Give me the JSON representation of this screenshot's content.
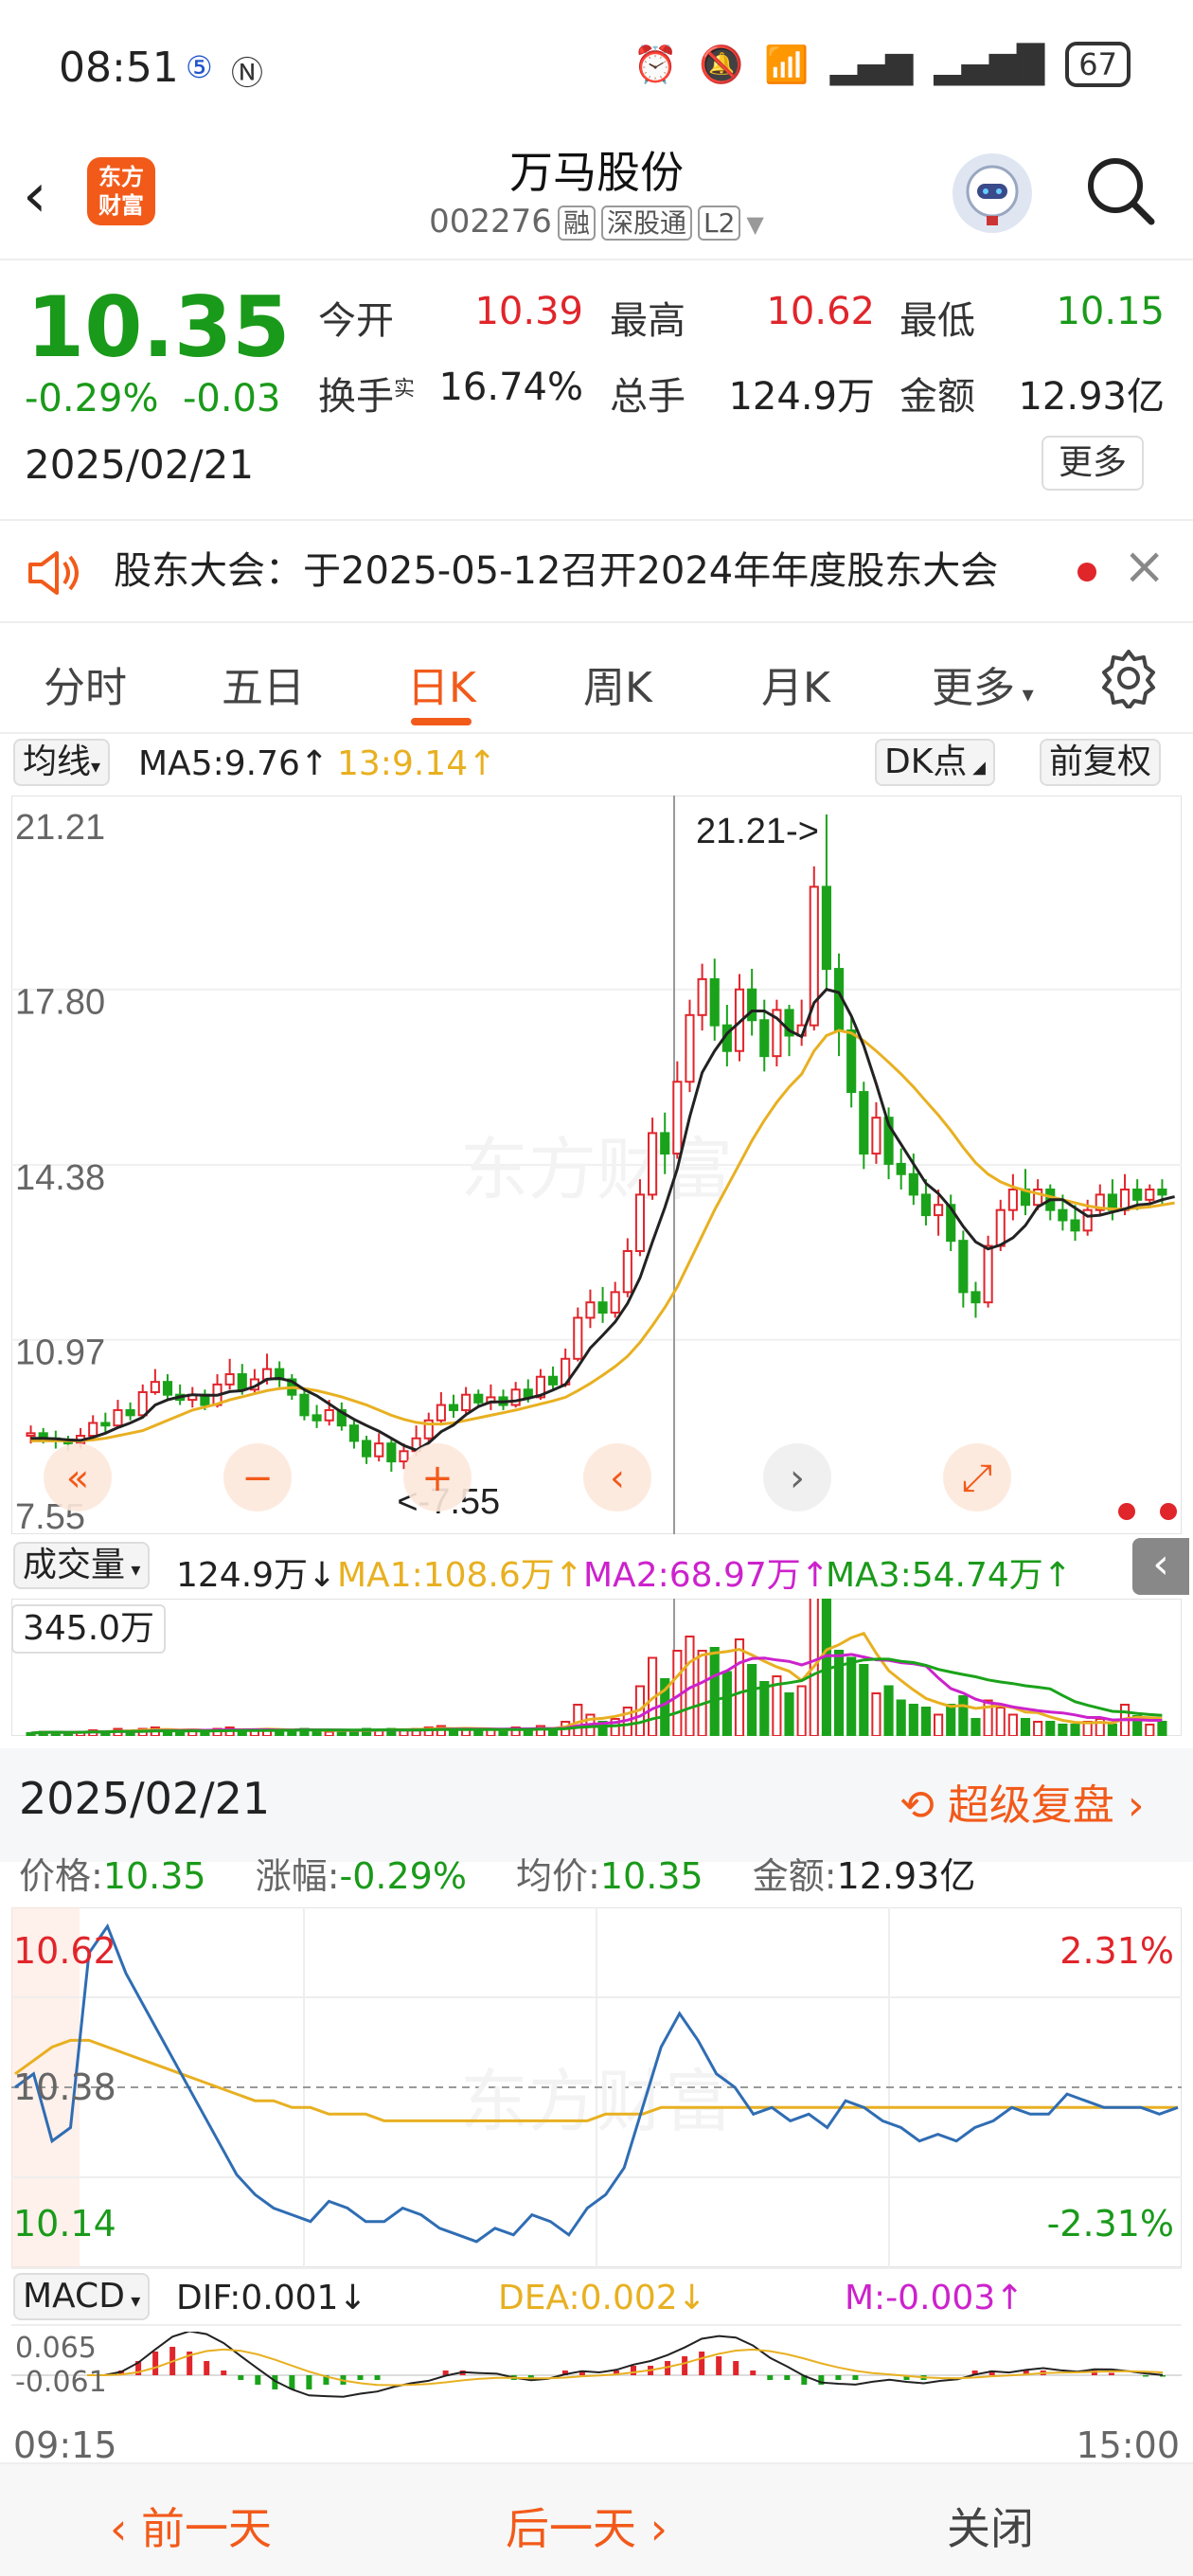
{
  "status": {
    "time": "08:51",
    "battery": "67"
  },
  "header": {
    "logo_line1": "东方",
    "logo_line2": "财富",
    "title": "万马股份",
    "code": "002276",
    "tags": [
      "融",
      "深股通",
      "L2"
    ]
  },
  "quote": {
    "price": "10.35",
    "change_pct": "-0.29%",
    "change_abs": "-0.03",
    "date": "2025/02/21",
    "open_label": "今开",
    "open": "10.39",
    "high_label": "最高",
    "high": "10.62",
    "low_label": "最低",
    "low": "10.15",
    "turnover_label": "换手",
    "turnover_sup": "实",
    "turnover": "16.74%",
    "volume_label": "总手",
    "volume": "124.9万",
    "amount_label": "金额",
    "amount": "12.93亿",
    "more": "更多"
  },
  "notice": {
    "text": "股东大会：于2025-05-12召开2024年年度股东大会"
  },
  "tabs": [
    "分时",
    "五日",
    "日K",
    "周K",
    "月K",
    "更多"
  ],
  "active_tab": "日K",
  "ma_bar": {
    "selector": "均线",
    "ma5": "MA5:9.76↑",
    "ma13": "13:9.14↑",
    "dk": "DK点",
    "fq": "前复权"
  },
  "kline": {
    "y_labels": [
      "21.21",
      "17.80",
      "14.38",
      "10.97",
      "7.55"
    ],
    "max_annot": "21.21->",
    "min_annot": "<-7.55",
    "watermark": "东方财富",
    "colors": {
      "up": "#e0252b",
      "down": "#1aa31a",
      "ma5": "#222222",
      "ma13": "#e8b021"
    },
    "candles": [
      [
        9.1,
        9.15,
        8.95,
        9.3
      ],
      [
        9.15,
        9.05,
        8.95,
        9.25
      ],
      [
        9.05,
        9.0,
        8.85,
        9.2
      ],
      [
        9.0,
        8.95,
        8.8,
        9.1
      ],
      [
        8.95,
        9.1,
        8.85,
        9.25
      ],
      [
        9.1,
        9.35,
        9.05,
        9.5
      ],
      [
        9.35,
        9.3,
        9.15,
        9.55
      ],
      [
        9.3,
        9.6,
        9.25,
        9.8
      ],
      [
        9.6,
        9.5,
        9.4,
        9.75
      ],
      [
        9.5,
        9.95,
        9.45,
        10.1
      ],
      [
        9.95,
        10.15,
        9.9,
        10.4
      ],
      [
        10.15,
        9.9,
        9.8,
        10.3
      ],
      [
        9.9,
        9.8,
        9.7,
        10.1
      ],
      [
        9.8,
        9.9,
        9.65,
        10.05
      ],
      [
        9.9,
        9.7,
        9.6,
        10.0
      ],
      [
        9.7,
        10.1,
        9.65,
        10.3
      ],
      [
        10.1,
        10.3,
        10.0,
        10.6
      ],
      [
        10.3,
        10.0,
        9.9,
        10.5
      ],
      [
        10.0,
        10.2,
        9.9,
        10.4
      ],
      [
        10.2,
        10.4,
        10.1,
        10.7
      ],
      [
        10.4,
        10.2,
        10.05,
        10.55
      ],
      [
        10.2,
        9.9,
        9.8,
        10.3
      ],
      [
        9.9,
        9.5,
        9.4,
        10.0
      ],
      [
        9.5,
        9.4,
        9.25,
        9.7
      ],
      [
        9.4,
        9.6,
        9.3,
        9.8
      ],
      [
        9.6,
        9.3,
        9.2,
        9.75
      ],
      [
        9.3,
        9.0,
        8.85,
        9.4
      ],
      [
        9.0,
        8.7,
        8.55,
        9.1
      ],
      [
        8.7,
        8.95,
        8.6,
        9.15
      ],
      [
        8.95,
        8.6,
        8.4,
        9.05
      ],
      [
        8.6,
        8.8,
        8.45,
        8.95
      ],
      [
        8.8,
        9.05,
        8.7,
        9.3
      ],
      [
        9.05,
        9.4,
        8.95,
        9.55
      ],
      [
        9.4,
        9.7,
        9.3,
        9.95
      ],
      [
        9.7,
        9.6,
        9.45,
        9.9
      ],
      [
        9.6,
        9.9,
        9.5,
        10.05
      ],
      [
        9.9,
        9.75,
        9.65,
        10.0
      ],
      [
        9.75,
        9.85,
        9.6,
        10.1
      ],
      [
        9.85,
        9.7,
        9.6,
        10.0
      ],
      [
        9.7,
        10.0,
        9.65,
        10.15
      ],
      [
        10.0,
        9.85,
        9.75,
        10.2
      ],
      [
        9.85,
        10.25,
        9.8,
        10.4
      ],
      [
        10.25,
        10.1,
        10.0,
        10.45
      ],
      [
        10.1,
        10.6,
        10.05,
        10.8
      ],
      [
        10.6,
        11.4,
        10.55,
        11.6
      ],
      [
        11.4,
        11.7,
        11.2,
        11.95
      ],
      [
        11.7,
        11.5,
        11.3,
        12.0
      ],
      [
        11.5,
        11.9,
        11.4,
        12.1
      ],
      [
        11.9,
        12.7,
        11.8,
        12.95
      ],
      [
        12.7,
        13.8,
        12.6,
        14.1
      ],
      [
        13.8,
        15.0,
        13.7,
        15.3
      ],
      [
        15.0,
        14.6,
        14.2,
        15.4
      ],
      [
        14.6,
        16.0,
        14.5,
        16.4
      ],
      [
        16.0,
        17.3,
        15.8,
        17.6
      ],
      [
        17.3,
        18.0,
        17.0,
        18.3
      ],
      [
        18.0,
        17.1,
        16.8,
        18.4
      ],
      [
        17.1,
        16.6,
        16.3,
        17.5
      ],
      [
        16.6,
        17.8,
        16.4,
        18.1
      ],
      [
        17.8,
        17.2,
        16.9,
        18.2
      ],
      [
        17.2,
        16.5,
        16.2,
        17.6
      ],
      [
        16.5,
        17.4,
        16.3,
        17.6
      ],
      [
        17.4,
        16.9,
        16.5,
        17.5
      ],
      [
        16.9,
        17.1,
        16.7,
        17.6
      ],
      [
        17.1,
        19.8,
        17.0,
        20.2
      ],
      [
        19.8,
        18.2,
        17.8,
        21.21
      ],
      [
        18.2,
        17.0,
        16.5,
        18.5
      ],
      [
        17.0,
        15.8,
        15.5,
        17.3
      ],
      [
        15.8,
        14.6,
        14.3,
        16.0
      ],
      [
        14.6,
        15.3,
        14.4,
        15.6
      ],
      [
        15.3,
        14.4,
        14.1,
        15.5
      ],
      [
        14.4,
        14.2,
        13.9,
        14.7
      ],
      [
        14.2,
        13.8,
        13.6,
        14.6
      ],
      [
        13.8,
        13.4,
        13.2,
        14.1
      ],
      [
        13.4,
        13.6,
        13.0,
        13.9
      ],
      [
        13.6,
        12.9,
        12.7,
        13.8
      ],
      [
        12.9,
        11.9,
        11.6,
        13.1
      ],
      [
        11.9,
        11.7,
        11.4,
        12.1
      ],
      [
        11.7,
        12.8,
        11.6,
        13.0
      ],
      [
        12.8,
        13.5,
        12.7,
        13.7
      ],
      [
        13.5,
        13.9,
        13.3,
        14.2
      ],
      [
        13.9,
        13.6,
        13.4,
        14.3
      ],
      [
        13.6,
        13.9,
        13.5,
        14.1
      ],
      [
        13.9,
        13.5,
        13.3,
        14.0
      ],
      [
        13.5,
        13.3,
        13.1,
        13.8
      ],
      [
        13.3,
        13.1,
        12.9,
        13.6
      ],
      [
        13.1,
        13.5,
        13.0,
        13.7
      ],
      [
        13.5,
        13.8,
        13.4,
        14.0
      ],
      [
        13.8,
        13.5,
        13.3,
        14.1
      ],
      [
        13.5,
        13.9,
        13.4,
        14.2
      ],
      [
        13.9,
        13.7,
        13.5,
        14.1
      ],
      [
        13.7,
        13.9,
        13.6,
        14.0
      ],
      [
        13.9,
        13.8,
        13.6,
        14.1
      ]
    ],
    "ma5_series": [
      9.05,
      9.05,
      9.04,
      9.02,
      9.01,
      9.07,
      9.15,
      9.26,
      9.35,
      9.46,
      9.7,
      9.8,
      9.86,
      9.9,
      9.89,
      9.89,
      9.96,
      9.98,
      10.06,
      10.2,
      10.22,
      10.16,
      10.0,
      9.88,
      9.72,
      9.56,
      9.42,
      9.3,
      9.19,
      9.05,
      8.91,
      8.82,
      8.96,
      9.18,
      9.31,
      9.51,
      9.67,
      9.76,
      9.76,
      9.78,
      9.83,
      9.89,
      9.99,
      10.1,
      10.44,
      10.81,
      11.06,
      11.32,
      11.68,
      12.18,
      12.88,
      13.55,
      14.3,
      15.32,
      16.18,
      16.6,
      16.94,
      17.16,
      17.38,
      17.38,
      17.24,
      17.0,
      16.88,
      17.54,
      17.8,
      17.74,
      17.28,
      16.7,
      15.96,
      15.16,
      14.78,
      14.4,
      14.02,
      13.82,
      13.54,
      13.18,
      12.88,
      12.74,
      12.82,
      12.96,
      13.2,
      13.56,
      13.7,
      13.7,
      13.54,
      13.38,
      13.4,
      13.46,
      13.52,
      13.6,
      13.62,
      13.7,
      13.76
    ],
    "ma13_series": [
      9.0,
      9.0,
      9.0,
      9.0,
      9.0,
      9.02,
      9.05,
      9.1,
      9.15,
      9.2,
      9.3,
      9.4,
      9.5,
      9.6,
      9.66,
      9.72,
      9.8,
      9.86,
      9.92,
      9.98,
      10.02,
      10.04,
      10.02,
      9.98,
      9.92,
      9.86,
      9.78,
      9.7,
      9.6,
      9.5,
      9.42,
      9.36,
      9.33,
      9.33,
      9.35,
      9.4,
      9.45,
      9.5,
      9.55,
      9.6,
      9.66,
      9.72,
      9.78,
      9.85,
      9.98,
      10.12,
      10.28,
      10.45,
      10.65,
      10.92,
      11.25,
      11.6,
      12.0,
      12.5,
      13.0,
      13.5,
      13.95,
      14.4,
      14.85,
      15.25,
      15.6,
      15.9,
      16.15,
      16.6,
      16.9,
      17.0,
      16.95,
      16.8,
      16.6,
      16.38,
      16.15,
      15.9,
      15.62,
      15.35,
      15.05,
      14.72,
      14.42,
      14.2,
      14.05,
      13.95,
      13.88,
      13.82,
      13.76,
      13.7,
      13.64,
      13.58,
      13.54,
      13.52,
      13.52,
      13.54,
      13.56,
      13.6,
      13.64
    ]
  },
  "vol_bar": {
    "selector": "成交量",
    "vol": "124.9万↓",
    "ma1": "MA1:108.6万↑",
    "ma2": "MA2:68.97万↑",
    "ma3": "MA3:54.74万↑",
    "max_label": "345.0万",
    "colors": {
      "ma1": "#e8b021",
      "ma2": "#cc22cc",
      "ma3": "#1aa31a"
    }
  },
  "volume_series": [
    [
      2,
      0
    ],
    [
      3,
      0
    ],
    [
      3,
      0
    ],
    [
      2,
      0
    ],
    [
      3,
      1
    ],
    [
      4,
      1
    ],
    [
      3,
      0
    ],
    [
      5,
      1
    ],
    [
      3,
      0
    ],
    [
      5,
      1
    ],
    [
      6,
      1
    ],
    [
      4,
      0
    ],
    [
      3,
      0
    ],
    [
      4,
      1
    ],
    [
      3,
      0
    ],
    [
      5,
      1
    ],
    [
      6,
      1
    ],
    [
      4,
      0
    ],
    [
      4,
      1
    ],
    [
      5,
      1
    ],
    [
      4,
      0
    ],
    [
      4,
      0
    ],
    [
      5,
      0
    ],
    [
      3,
      0
    ],
    [
      3,
      1
    ],
    [
      4,
      0
    ],
    [
      4,
      0
    ],
    [
      5,
      0
    ],
    [
      4,
      1
    ],
    [
      5,
      0
    ],
    [
      4,
      1
    ],
    [
      5,
      1
    ],
    [
      6,
      1
    ],
    [
      7,
      1
    ],
    [
      4,
      0
    ],
    [
      5,
      1
    ],
    [
      4,
      0
    ],
    [
      5,
      1
    ],
    [
      4,
      0
    ],
    [
      6,
      1
    ],
    [
      4,
      0
    ],
    [
      7,
      1
    ],
    [
      5,
      0
    ],
    [
      10,
      1
    ],
    [
      22,
      1
    ],
    [
      15,
      1
    ],
    [
      10,
      0
    ],
    [
      12,
      1
    ],
    [
      20,
      1
    ],
    [
      35,
      1
    ],
    [
      55,
      1
    ],
    [
      40,
      0
    ],
    [
      60,
      1
    ],
    [
      70,
      1
    ],
    [
      60,
      1
    ],
    [
      62,
      0
    ],
    [
      45,
      0
    ],
    [
      68,
      1
    ],
    [
      50,
      0
    ],
    [
      38,
      0
    ],
    [
      42,
      1
    ],
    [
      30,
      0
    ],
    [
      35,
      1
    ],
    [
      100,
      1
    ],
    [
      96,
      0
    ],
    [
      60,
      0
    ],
    [
      55,
      0
    ],
    [
      50,
      0
    ],
    [
      30,
      1
    ],
    [
      35,
      0
    ],
    [
      25,
      0
    ],
    [
      22,
      0
    ],
    [
      20,
      0
    ],
    [
      15,
      1
    ],
    [
      22,
      0
    ],
    [
      28,
      0
    ],
    [
      12,
      0
    ],
    [
      25,
      1
    ],
    [
      20,
      1
    ],
    [
      15,
      1
    ],
    [
      12,
      0
    ],
    [
      10,
      1
    ],
    [
      10,
      0
    ],
    [
      8,
      0
    ],
    [
      8,
      0
    ],
    [
      10,
      1
    ],
    [
      12,
      1
    ],
    [
      8,
      0
    ],
    [
      22,
      1
    ],
    [
      14,
      0
    ],
    [
      8,
      1
    ],
    [
      10,
      0
    ]
  ],
  "panel": {
    "date": "2025/02/21",
    "replay": "超级复盘",
    "price_label": "价格:",
    "price": "10.35",
    "chg_label": "涨幅:",
    "chg": "-0.29%",
    "avg_label": "均价:",
    "avg": "10.35",
    "amt_label": "金额:",
    "amt": "12.93亿",
    "y_high": "10.62",
    "y_mid": "10.38",
    "y_low": "10.14",
    "pct_high": "2.31%",
    "pct_low": "-2.31%",
    "macd_selector": "MACD",
    "dif": "DIF:0.001↓",
    "dea": "DEA:0.002↓",
    "m": "M:-0.003↑",
    "macd_top": "0.065",
    "macd_bottom": "-0.061",
    "t_start": "09:15",
    "t_end": "15:00",
    "intraday": [
      10.38,
      10.4,
      10.3,
      10.32,
      10.58,
      10.62,
      10.55,
      10.5,
      10.45,
      10.4,
      10.35,
      10.3,
      10.25,
      10.22,
      10.2,
      10.19,
      10.18,
      10.21,
      10.2,
      10.18,
      10.18,
      10.2,
      10.19,
      10.17,
      10.16,
      10.15,
      10.17,
      10.16,
      10.19,
      10.18,
      10.16,
      10.2,
      10.22,
      10.26,
      10.35,
      10.44,
      10.49,
      10.45,
      10.4,
      10.38,
      10.34,
      10.35,
      10.33,
      10.34,
      10.32,
      10.36,
      10.35,
      10.33,
      10.32,
      10.3,
      10.31,
      10.3,
      10.32,
      10.33,
      10.35,
      10.34,
      10.34,
      10.37,
      10.36,
      10.35,
      10.35,
      10.35,
      10.34,
      10.35
    ],
    "avg_line": [
      10.4,
      10.42,
      10.44,
      10.45,
      10.45,
      10.44,
      10.43,
      10.42,
      10.41,
      10.4,
      10.39,
      10.38,
      10.37,
      10.36,
      10.36,
      10.35,
      10.35,
      10.34,
      10.34,
      10.34,
      10.33,
      10.33,
      10.33,
      10.33,
      10.33,
      10.33,
      10.33,
      10.33,
      10.33,
      10.33,
      10.33,
      10.33,
      10.34,
      10.34,
      10.34,
      10.35,
      10.35,
      10.35,
      10.35,
      10.35,
      10.35,
      10.35,
      10.35,
      10.35,
      10.35,
      10.35,
      10.35,
      10.35,
      10.35,
      10.35,
      10.35,
      10.35,
      10.35,
      10.35,
      10.35,
      10.35,
      10.35,
      10.35,
      10.35,
      10.35,
      10.35,
      10.35,
      10.35,
      10.35
    ],
    "macd_hist": [
      0,
      0,
      0.01,
      0.03,
      0.05,
      0.06,
      0.05,
      0.03,
      0.01,
      -0.01,
      -0.02,
      -0.03,
      -0.03,
      -0.03,
      -0.02,
      -0.02,
      -0.01,
      -0.01,
      0,
      0,
      0,
      0.01,
      0.01,
      0,
      0,
      -0.01,
      -0.01,
      0,
      0.01,
      0.01,
      0,
      0.01,
      0.02,
      0.02,
      0.03,
      0.04,
      0.05,
      0.04,
      0.03,
      0.01,
      -0.01,
      -0.01,
      -0.02,
      -0.02,
      -0.01,
      -0.01,
      0,
      0,
      -0.01,
      -0.01,
      0,
      0,
      0.01,
      0.01,
      0,
      0.01,
      0.01,
      0,
      0,
      0.01,
      0.005,
      0,
      -0.003,
      -0.003
    ]
  },
  "bottom": {
    "prev": "前一天",
    "next": "后一天",
    "close": "关闭"
  }
}
